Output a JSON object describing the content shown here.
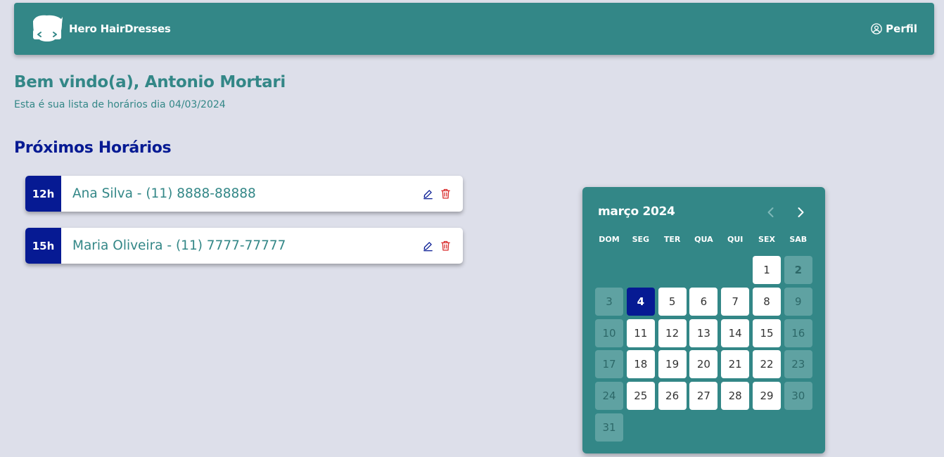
{
  "header": {
    "brand_name": "Hero HairDresses",
    "profile_label": "Perfil"
  },
  "welcome": {
    "title": "Bem vindo(a), Antonio Mortari",
    "subtitle": "Esta é sua lista de horários dia 04/03/2024"
  },
  "section_title": "Próximos Horários",
  "appointments": [
    {
      "time": "12h",
      "label": "Ana Silva - (11) 8888-88888"
    },
    {
      "time": "15h",
      "label": "Maria Oliveira - (11) 7777-77777"
    }
  ],
  "calendar": {
    "month_label": "março 2024",
    "weekdays": [
      "DOM",
      "SEG",
      "TER",
      "QUA",
      "QUI",
      "SEX",
      "SAB"
    ],
    "first_weekday_index": 5,
    "days_in_month": 31,
    "selected_day": 4,
    "bold_days": [
      2
    ]
  },
  "colors": {
    "primary": "#338787",
    "accent": "#061a93",
    "background": "#dddfea",
    "delete": "#d92b2b",
    "weekend_cell": "#5fa2a2"
  },
  "icons": {
    "logo": "hero-mask-logo",
    "profile": "user-circle-icon",
    "edit": "pencil-icon",
    "delete": "trash-icon",
    "prev": "chevron-left-icon",
    "next": "chevron-right-icon"
  }
}
